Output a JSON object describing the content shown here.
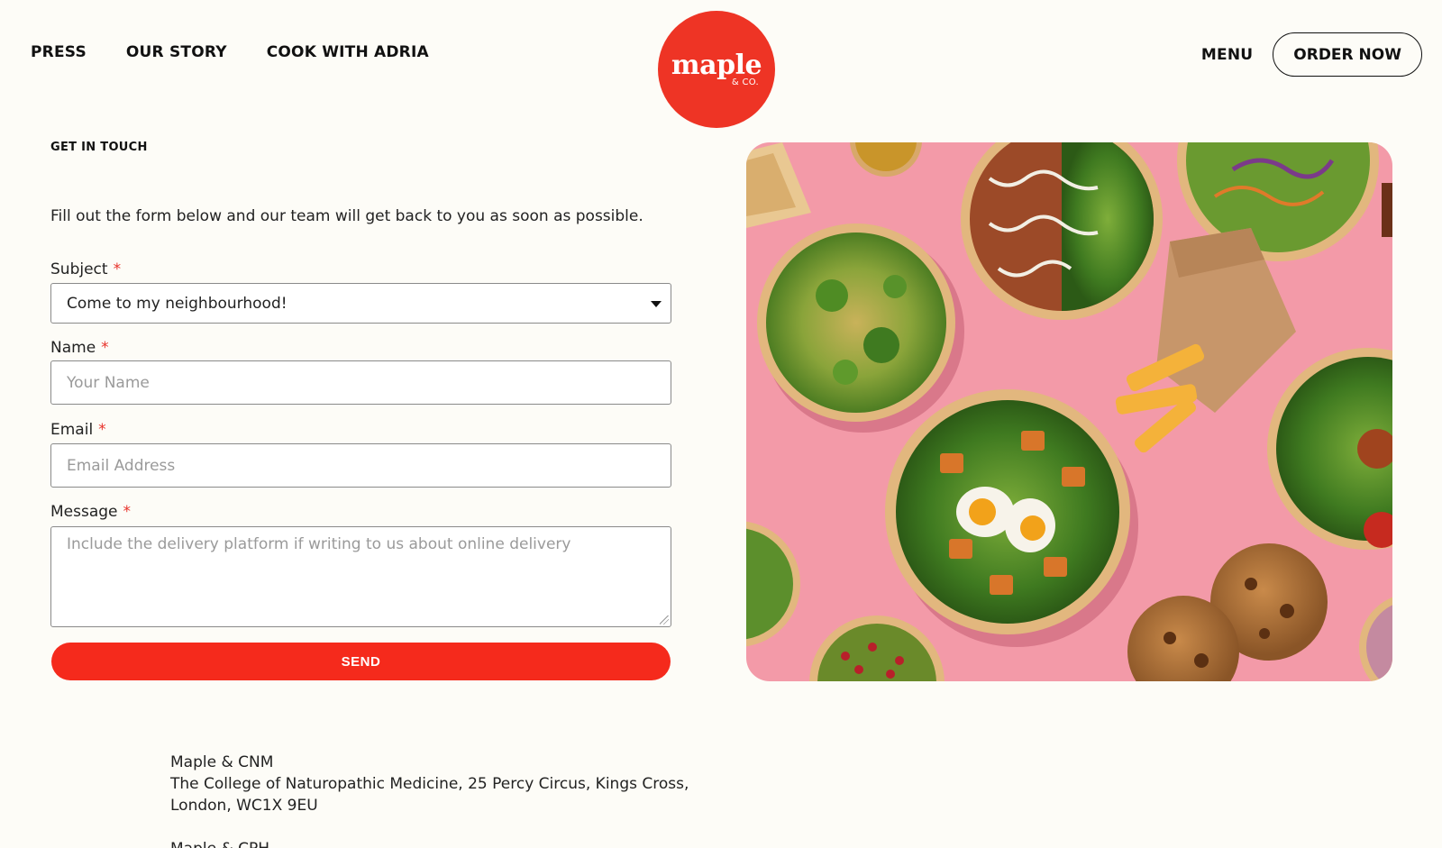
{
  "header": {
    "nav_left": [
      "PRESS",
      "OUR STORY",
      "COOK WITH ADRIA"
    ],
    "logo_word": "maple",
    "logo_sub": "& CO.",
    "menu_label": "MENU",
    "order_label": "ORDER NOW"
  },
  "form": {
    "eyebrow": "GET IN TOUCH",
    "intro": "Fill out the form below and our team will get back to you as soon as possible.",
    "required_mark": "*",
    "subject_label": "Subject",
    "subject_value": "Come to my neighbourhood!",
    "name_label": "Name",
    "name_placeholder": "Your Name",
    "email_label": "Email",
    "email_placeholder": "Email Address",
    "message_label": "Message",
    "message_placeholder": "Include the delivery platform if writing to us about online delivery",
    "send_label": "SEND"
  },
  "locations": [
    {
      "name": "Maple & CNM",
      "address_line1": "The College of Naturopathic Medicine, 25 Percy Circus, Kings Cross,",
      "address_line2": "London, WC1X 9EU"
    },
    {
      "name": "Maple & CPH"
    }
  ],
  "colors": {
    "brand_red": "#ee3425",
    "send_red": "#f52a1c",
    "hero_pink": "#f39aa8",
    "page_bg": "#fdfcf7"
  }
}
